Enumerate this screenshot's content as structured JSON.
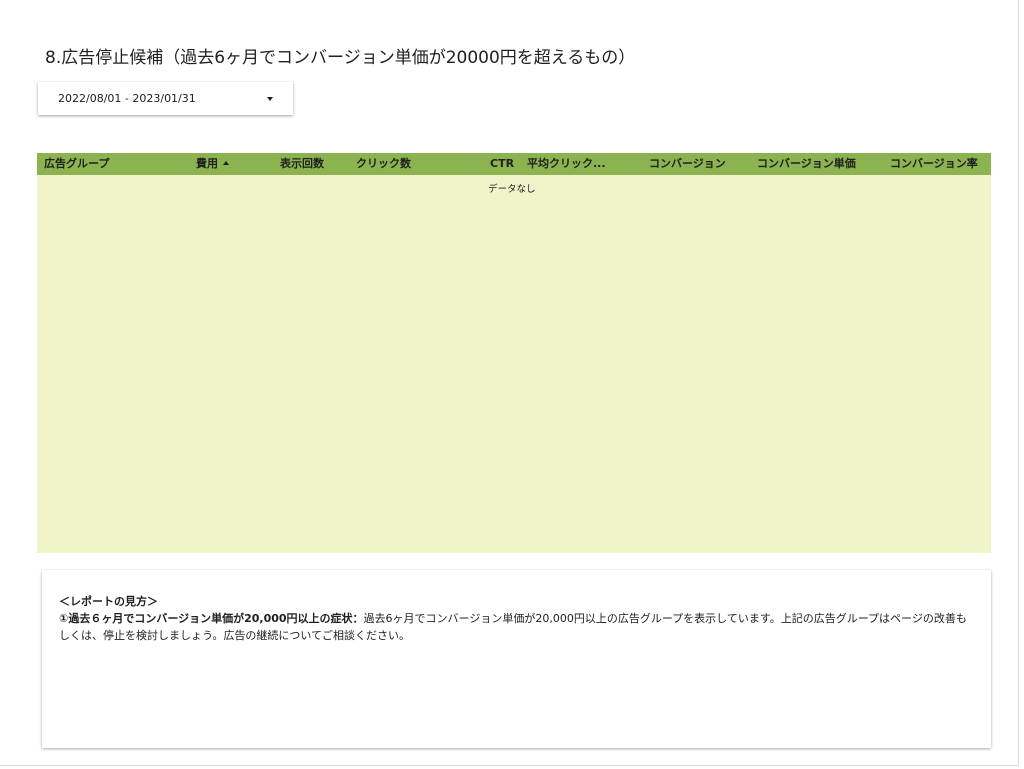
{
  "page": {
    "title": "8.広告停止候補（過去6ヶ月でコンバージョン単価が20000円を超えるもの）"
  },
  "date_range": {
    "value": "2022/08/01 - 2023/01/31",
    "icon": "arrow-drop-down-icon"
  },
  "table": {
    "header_color": "#8bb34f",
    "body_color": "#f1f4c9",
    "columns": [
      "広告グループ",
      "費用",
      "表示回数",
      "クリック数",
      "CTR",
      "平均クリック...",
      "コンバージョン",
      "コンバージョン単価",
      "コンバージョン率"
    ],
    "sorted_column": "費用",
    "sort_direction": "ascending",
    "empty_message": "データなし"
  },
  "notes": {
    "heading": "＜レポートの見方＞",
    "item_lead": "①過去６ヶ月でコンバージョン単価が20,000円以上の症状：",
    "item_text": "過去6ヶ月でコンバージョン単価が20,000円以上の広告グループを表示しています。上記の広告グループはページの改善もしくは、停止を検討しましょう。広告の継続についてご相談ください。"
  }
}
